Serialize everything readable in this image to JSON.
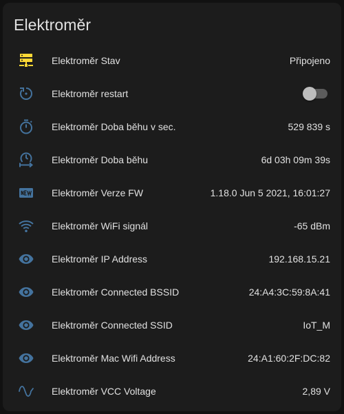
{
  "card": {
    "title": "Elektroměr"
  },
  "colors": {
    "icon_default": "#44739e",
    "icon_active": "#fdd835",
    "text": "#e1e1e1",
    "card_bg": "#1c1c1c"
  },
  "rows": [
    {
      "icon": "server-network-icon",
      "label": "Elektroměr Stav",
      "value": "Připojeno"
    },
    {
      "icon": "restart-icon",
      "label": "Elektroměr restart",
      "toggle": false
    },
    {
      "icon": "timer-icon",
      "label": "Elektroměr Doba běhu v sec.",
      "value": "529 839 s"
    },
    {
      "icon": "clock-start-icon",
      "label": "Elektroměr Doba běhu",
      "value": "6d 03h 09m 39s"
    },
    {
      "icon": "new-box-icon",
      "label": "Elektroměr Verze FW",
      "value": "1.18.0 Jun 5 2021, 16:01:27"
    },
    {
      "icon": "wifi-icon",
      "label": "Elektroměr WiFi signál",
      "value": "-65 dBm"
    },
    {
      "icon": "eye-icon",
      "label": "Elektroměr IP Address",
      "value": "192.168.15.21"
    },
    {
      "icon": "eye-icon",
      "label": "Elektroměr Connected BSSID",
      "value": "24:A4:3C:59:8A:41"
    },
    {
      "icon": "eye-icon",
      "label": "Elektroměr Connected SSID",
      "value": "IoT_M"
    },
    {
      "icon": "eye-icon",
      "label": "Elektroměr Mac Wifi Address",
      "value": "24:A1:60:2F:DC:82"
    },
    {
      "icon": "sine-wave-icon",
      "label": "Elektroměr VCC Voltage",
      "value": "2,89 V"
    }
  ]
}
